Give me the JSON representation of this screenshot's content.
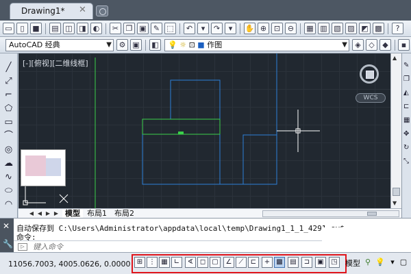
{
  "tabs": {
    "doc_title": "Drawing1*",
    "close": "✕"
  },
  "toolbar": {
    "workspace": "AutoCAD 经典",
    "layer_name": "作图"
  },
  "canvas": {
    "viewport_label": "[-][俯视][二维线框]",
    "wcs_label": "WCS"
  },
  "layout_tabs": [
    "模型",
    "布局1",
    "布局2"
  ],
  "command": {
    "history": [
      "自动保存到 C:\\Users\\Administrator\\appdata\\local\\temp\\Drawing1_1_1_4291.sv$",
      "命令:"
    ],
    "placeholder": "键入命令"
  },
  "status": {
    "coords": "11056.7003, 4005.0626, 0.0000",
    "model_label": "模型"
  },
  "colors": {
    "canvas_bg": "#212830",
    "geometry_blue": "#2d7fd9",
    "selection_green": "#3ad14a",
    "highlight_red": "#e0141b"
  }
}
